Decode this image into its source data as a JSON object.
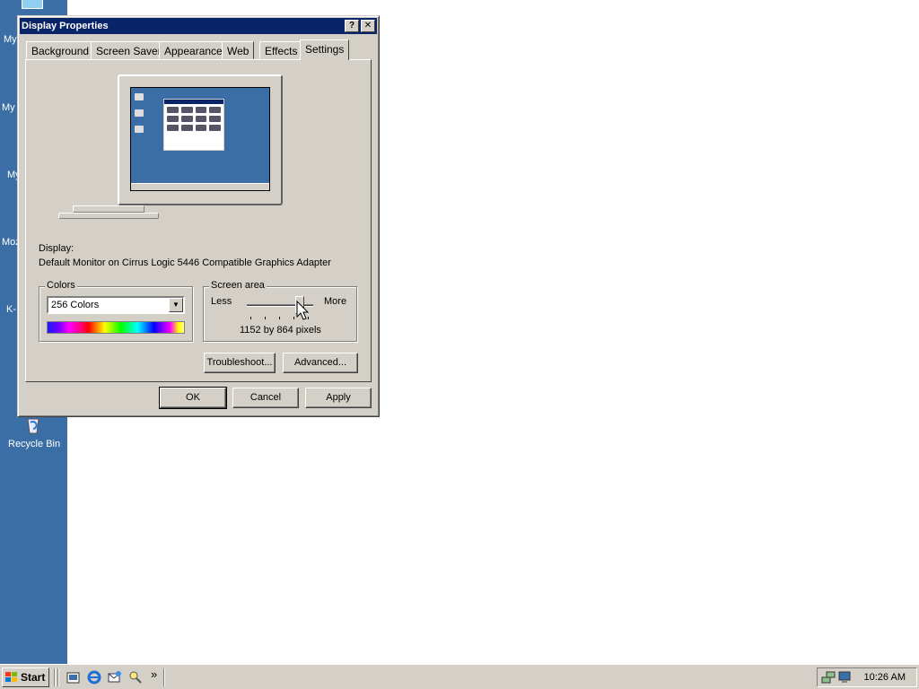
{
  "desktop": {
    "icon_labels": [
      "My",
      "My",
      "My",
      "Moz",
      "K-I"
    ],
    "recycle_bin_label": "Recycle Bin"
  },
  "dialog": {
    "title": "Display Properties",
    "help_label": "?",
    "close_label": "✕",
    "tabs": [
      "Background",
      "Screen Saver",
      "Appearance",
      "Web",
      "Effects",
      "Settings"
    ],
    "active_tab": "Settings",
    "display_label": "Display:",
    "display_value": "Default Monitor on Cirrus Logic 5446 Compatible Graphics Adapter",
    "colors": {
      "group_label": "Colors",
      "selected": "256 Colors"
    },
    "screen_area": {
      "group_label": "Screen area",
      "less_label": "Less",
      "more_label": "More",
      "resolution_text": "1152 by 864 pixels",
      "slider_fraction": 0.8
    },
    "troubleshoot_label": "Troubleshoot...",
    "advanced_label": "Advanced...",
    "ok_label": "OK",
    "cancel_label": "Cancel",
    "apply_label": "Apply"
  },
  "taskbar": {
    "start_label": "Start",
    "chevron": "»",
    "quick_launch": [
      "show-desktop-icon",
      "internet-explorer-icon",
      "outlook-express-icon",
      "search-icon"
    ],
    "clock": "10:26 AM"
  },
  "colors": {
    "desktop": "#3a6ea5",
    "titlebar": "#0a246a",
    "face": "#d4d0c8"
  }
}
